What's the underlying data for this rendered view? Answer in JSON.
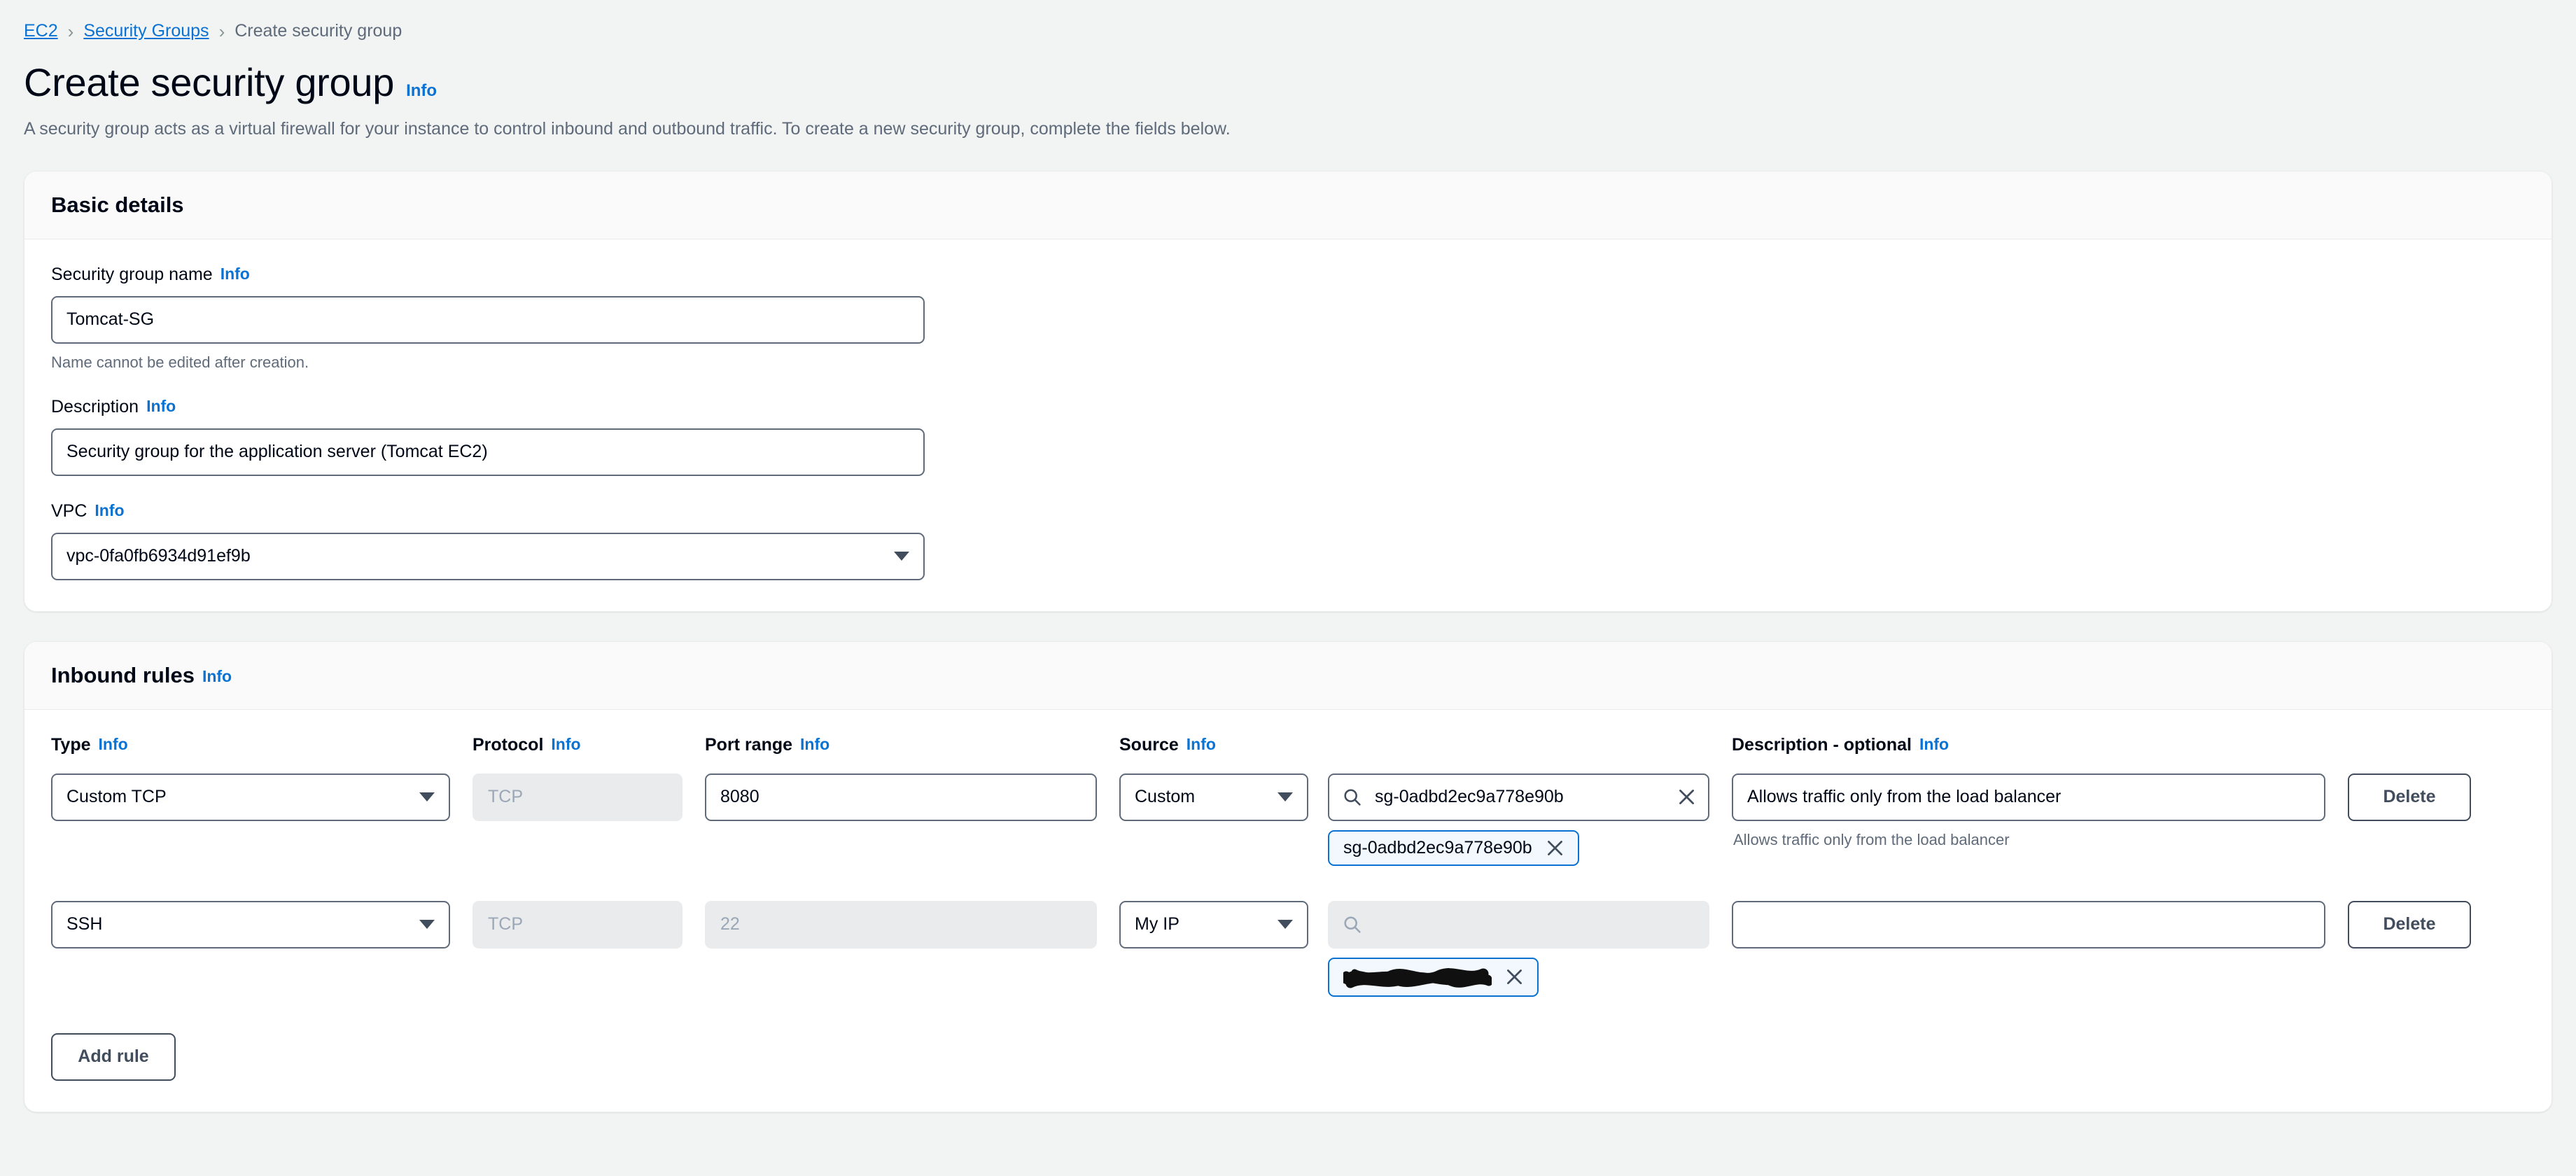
{
  "breadcrumb": {
    "items": [
      {
        "label": "EC2",
        "type": "link"
      },
      {
        "label": "Security Groups",
        "type": "link"
      },
      {
        "label": "Create security group",
        "type": "current"
      }
    ],
    "separator": "›"
  },
  "page": {
    "title": "Create security group",
    "info_label": "Info",
    "description": "A security group acts as a virtual firewall for your instance to control inbound and outbound traffic. To create a new security group, complete the fields below."
  },
  "basic_details": {
    "panel_title": "Basic details",
    "security_group_name": {
      "label": "Security group name",
      "info_label": "Info",
      "value": "Tomcat-SG",
      "hint": "Name cannot be edited after creation."
    },
    "description_field": {
      "label": "Description",
      "info_label": "Info",
      "value": "Security group for the application server (Tomcat EC2)"
    },
    "vpc": {
      "label": "VPC",
      "info_label": "Info",
      "value": "vpc-0fa0fb6934d91ef9b",
      "icon": "chevron-down-icon"
    }
  },
  "inbound_rules": {
    "panel_title": "Inbound rules",
    "info_label": "Info",
    "columns": [
      {
        "label": "Type",
        "info_label": "Info"
      },
      {
        "label": "Protocol",
        "info_label": "Info"
      },
      {
        "label": "Port range",
        "info_label": "Info"
      },
      {
        "label": "Source",
        "info_label": "Info"
      },
      {
        "label": "Description - optional",
        "info_label": "Info"
      }
    ],
    "rows": [
      {
        "type": "Custom TCP",
        "protocol": "TCP",
        "protocol_disabled": true,
        "port_range": "8080",
        "port_disabled": false,
        "source": "Custom",
        "search_value": "sg-0adbd2ec9a778e90b",
        "search_placeholder": "",
        "search_disabled": false,
        "has_clear": true,
        "chip_label": "sg-0adbd2ec9a778e90b",
        "chip_redacted": false,
        "description": "Allows traffic only from the load balancer",
        "description_hint": "Allows traffic only from the load balancer",
        "delete_label": "Delete"
      },
      {
        "type": "SSH",
        "protocol": "TCP",
        "protocol_disabled": true,
        "port_range": "22",
        "port_disabled": true,
        "source": "My IP",
        "search_value": "",
        "search_placeholder": "",
        "search_disabled": true,
        "has_clear": false,
        "chip_label": "",
        "chip_redacted": true,
        "description": "",
        "description_hint": "",
        "delete_label": "Delete"
      }
    ],
    "add_rule_label": "Add rule"
  },
  "icons": {
    "search": "search-icon",
    "clear": "close-icon",
    "chevron": "chevron-down-icon"
  },
  "colors": {
    "link": "#0972d3",
    "page_bg": "#f2f3f3",
    "panel_bg": "#ffffff",
    "panel_header_bg": "#fafafa",
    "border": "#5f6b7a",
    "muted_text": "#5f6b7a",
    "disabled_bg": "#e9ebed",
    "chip_bg": "#f2f8fd"
  }
}
